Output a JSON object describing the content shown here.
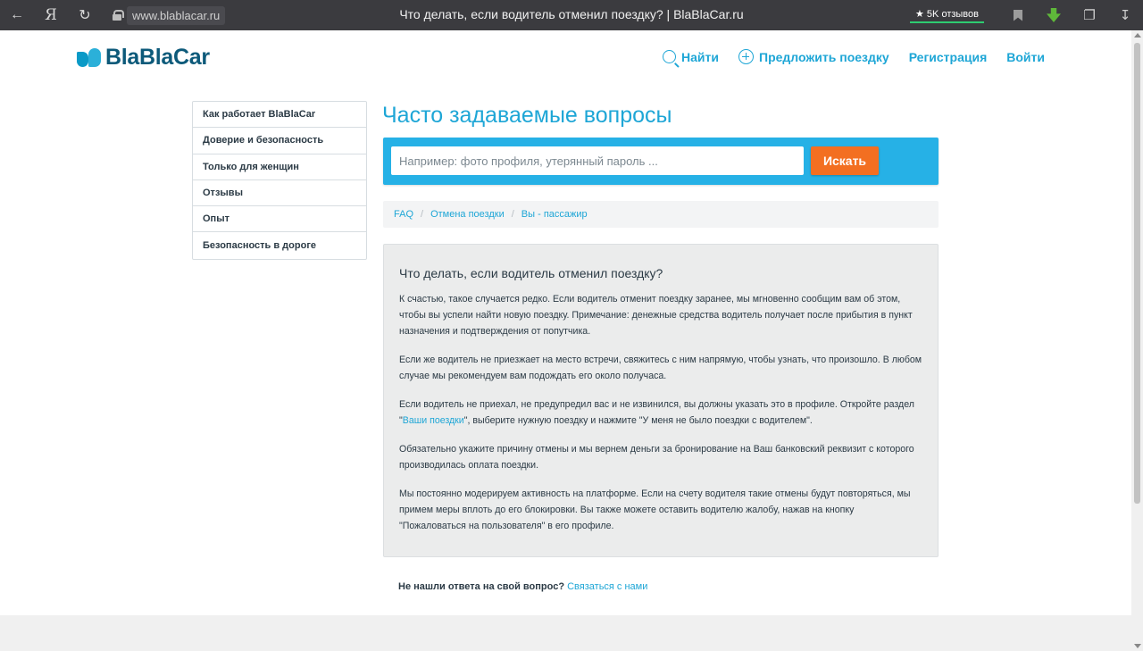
{
  "browser": {
    "back_icon": "arrow-left-icon",
    "yandex_label": "Я",
    "reload_icon": "reload-icon",
    "url": "www.blablacar.ru",
    "tab_title": "Что делать, если водитель отменил поездку? | BlaBlaCar.ru",
    "reviews_badge": "★ 5K отзывов"
  },
  "header": {
    "logo_text": "BlaBlaCar",
    "nav": {
      "find": "Найти",
      "offer": "Предложить поездку",
      "register": "Регистрация",
      "login": "Войти"
    }
  },
  "sidebar": {
    "items": [
      {
        "label": "Как работает BlaBlaCar"
      },
      {
        "label": "Доверие и безопасность"
      },
      {
        "label": "Только для женщин"
      },
      {
        "label": "Отзывы"
      },
      {
        "label": "Опыт"
      },
      {
        "label": "Безопасность в дороге"
      }
    ]
  },
  "main": {
    "title": "Часто задаваемые вопросы",
    "search": {
      "placeholder": "Например: фото профиля, утерянный пароль ...",
      "value": "",
      "button_label": "Искать"
    },
    "breadcrumb": {
      "items": [
        {
          "label": "FAQ"
        },
        {
          "label": "Отмена поездки"
        },
        {
          "label": "Вы - пассажир"
        }
      ],
      "separator": "/"
    },
    "article": {
      "heading": "Что делать, если водитель отменил поездку?",
      "p1": "К счастью, такое случается редко. Если водитель отменит поездку заранее, мы мгновенно сообщим вам об этом, чтобы вы успели найти новую поездку. Примечание: денежные средства водитель получает после прибытия в пункт назначения и подтверждения от попутчика.",
      "p2": "Если же водитель не приезжает на место встречи, свяжитесь с ним напрямую, чтобы узнать, что произошло. В любом случае мы рекомендуем вам подождать его около получаса.",
      "p3_before": "Если водитель не приехал, не предупредил вас и не извинился, вы должны указать это в профиле. Откройте раздел \"",
      "p3_link": "Ваши поездки",
      "p3_after": "\", выберите нужную поездку и нажмите \"У меня не было поездки с водителем\".",
      "p4": "Обязательно укажите причину отмены и мы вернем деньги за бронирование на Ваш банковский реквизит с которого производилась оплата поездки.",
      "p5": "Мы постоянно модерируем активность на платформе. Если на счету водителя такие отмены будут повторяться, мы примем меры вплоть до его блокировки. Вы также можете оставить водителю жалобу, нажав на кнопку \"Пожаловаться на пользователя\" в его профиле."
    },
    "contact": {
      "question": "Не нашли ответа на свой вопрос?",
      "link": "Связаться с нами"
    }
  },
  "colors": {
    "brand": "#1ea6d6",
    "search_band": "#26b1e6",
    "search_button": "#f36f21",
    "logo_dark": "#0d5a7a"
  }
}
